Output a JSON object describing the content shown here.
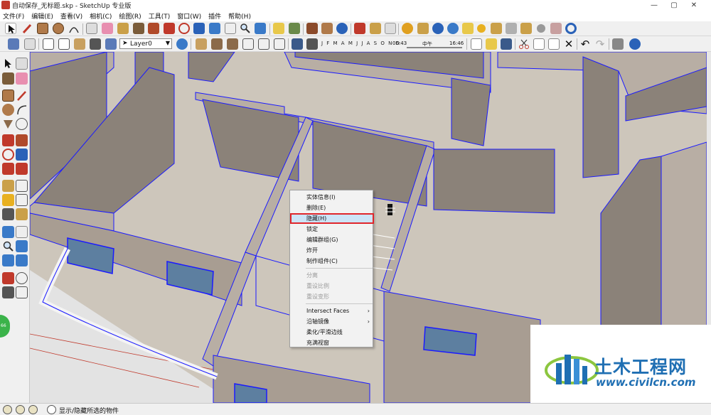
{
  "window": {
    "title": "自动保存_无标题.skp - SketchUp 专业版",
    "minimize": "—",
    "maximize": "▢",
    "close": "✕"
  },
  "menu": [
    "文件(F)",
    "编辑(E)",
    "查看(V)",
    "相机(C)",
    "绘图(R)",
    "工具(T)",
    "窗口(W)",
    "插件",
    "帮助(H)"
  ],
  "toolbar": {
    "layer_value": "Layer0",
    "months": "J F M A M J J A S O N D",
    "time_start": "06:43",
    "time_mid": "中午",
    "time_end": "16:46"
  },
  "context_menu": {
    "items": [
      {
        "label": "实体信息(I)",
        "enabled": true
      },
      {
        "label": "删除(E)",
        "enabled": true
      },
      {
        "label": "隐藏(H)",
        "enabled": true,
        "highlighted": true
      },
      {
        "label": "锁定",
        "enabled": true
      },
      {
        "label": "编辑群组(G)",
        "enabled": true
      },
      {
        "label": "炸开",
        "enabled": true
      },
      {
        "label": "制作组件(C)",
        "enabled": true
      },
      {
        "label": "分离",
        "enabled": false
      },
      {
        "label": "重设比例",
        "enabled": false
      },
      {
        "label": "重设变形",
        "enabled": false
      },
      {
        "label": "Intersect Faces",
        "enabled": true,
        "submenu": true
      },
      {
        "label": "沿轴镜像",
        "enabled": true,
        "submenu": true
      },
      {
        "label": "柔化/平滑边线",
        "enabled": true
      },
      {
        "label": "充满视窗",
        "enabled": true
      }
    ],
    "submenu_arrow": "›"
  },
  "status": {
    "text": "显示/隐藏所选的物件",
    "badge": "66"
  },
  "watermark": {
    "title": "土木工程网",
    "url": "www.civilcn.com"
  },
  "colors": {
    "wall_top": "#b8aea4",
    "wall_side": "#8b8279",
    "floor": "#cdc6bb",
    "selection": "#1a1aff",
    "highlight_border": "#e0262b"
  }
}
